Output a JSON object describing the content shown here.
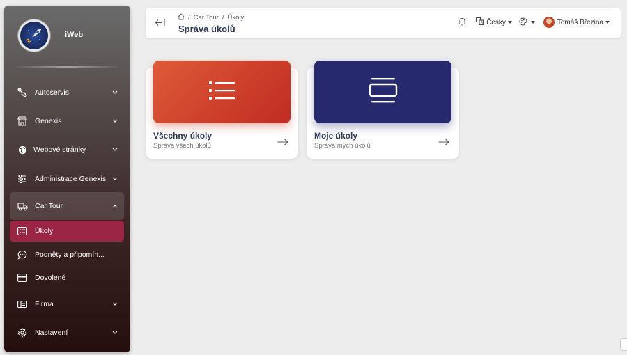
{
  "brand": {
    "name": "iWeb",
    "logo_icon": "rocket-icon"
  },
  "sidebar": {
    "items": [
      {
        "label": "Autoservis",
        "icon": "wrench-icon",
        "has_chevron": true
      },
      {
        "label": "Genexis",
        "icon": "store-icon",
        "has_chevron": true
      },
      {
        "label": "Webové stránky",
        "icon": "globe-icon",
        "has_chevron": true
      },
      {
        "label": "Administrace Genexis",
        "icon": "sliders-icon",
        "has_chevron": true
      },
      {
        "label": "Car Tour",
        "icon": "truck-icon",
        "has_chevron": true,
        "expanded": true
      },
      {
        "label": "Úkoly",
        "icon": "checklist-icon",
        "active": true
      },
      {
        "label": "Podněty a připomín...",
        "icon": "chat-icon"
      },
      {
        "label": "Dovolené",
        "icon": "card-icon"
      },
      {
        "label": "Firma",
        "icon": "id-card-icon",
        "has_chevron": true
      },
      {
        "label": "Nastavení",
        "icon": "gear-icon",
        "has_chevron": true
      }
    ]
  },
  "header": {
    "breadcrumb": [
      "Car Tour",
      "Úkoly"
    ],
    "title": "Správa úkolů",
    "language": "Česky",
    "user": "Tomáš Březina"
  },
  "cards": [
    {
      "title": "Všechny úkoly",
      "subtitle": "Správa všech úkolů",
      "icon": "list-icon",
      "color": "#d9462b"
    },
    {
      "title": "Moje úkoly",
      "subtitle": "Správa mých úkolů",
      "icon": "stack-icon",
      "color": "#27296e"
    }
  ],
  "colors": {
    "active": "#9b2545",
    "accent_title": "#2d3a5a"
  }
}
